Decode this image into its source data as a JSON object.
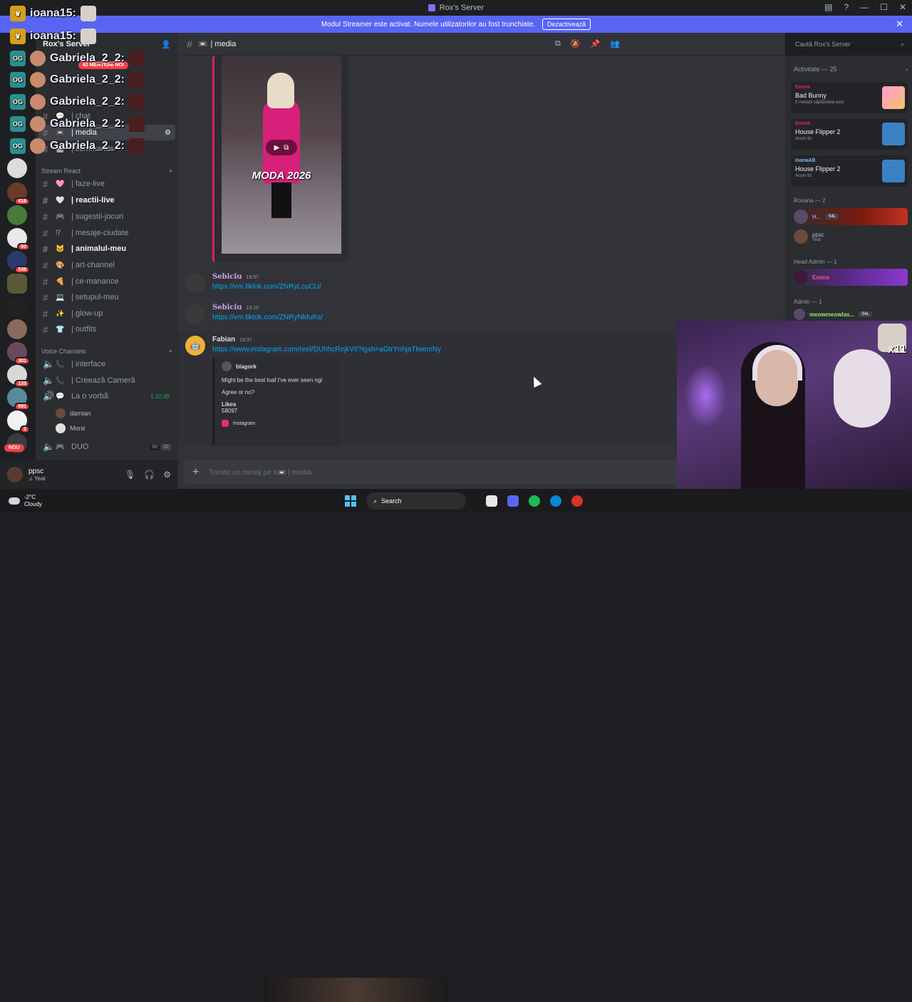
{
  "window": {
    "title": "Rox's Server"
  },
  "banner": {
    "text": "Modul Streamer este activat. Numele utilizatorilor au fost trunchiate.",
    "button": "Dezactivează"
  },
  "server_rail": {
    "badges": [
      "416",
      "60",
      "536",
      "301",
      "133",
      "591",
      "2"
    ],
    "new_label": "NOU"
  },
  "sidebar": {
    "server_name": "Rox's Server",
    "mentions": "62 MENȚIUNI NOI",
    "top_channels": [
      "| chat",
      "| media",
      "| commands"
    ],
    "category_stream": "Stream React",
    "channels": [
      {
        "emoji": "🩷",
        "name": "| faze-live",
        "bold": false
      },
      {
        "emoji": "🤍",
        "name": "| reactii-live",
        "bold": true
      },
      {
        "emoji": "🎮",
        "name": "| sugestii-jocuri",
        "bold": false
      },
      {
        "emoji": "⁉",
        "name": "| mesaje-ciudate",
        "bold": false
      },
      {
        "emoji": "🐱",
        "name": "| animalul-meu",
        "bold": true
      },
      {
        "emoji": "🎨",
        "name": "| art-channel",
        "bold": false
      },
      {
        "emoji": "🍕",
        "name": "| ce-manance",
        "bold": false
      },
      {
        "emoji": "💻",
        "name": "| setupul-meu",
        "bold": false
      },
      {
        "emoji": "✨",
        "name": "| glow-up",
        "bold": false
      },
      {
        "emoji": "👕",
        "name": "| outfits",
        "bold": false
      }
    ],
    "category_voice": "Voice Channels",
    "voice_channels": [
      {
        "emoji": "📞",
        "name": "| interface"
      },
      {
        "emoji": "📞",
        "name": "| Creează Cameră"
      },
      {
        "emoji": "💬",
        "name": "La o vorbă",
        "timer": "1:32:49"
      }
    ],
    "voice_users": [
      "damian",
      "Monii"
    ],
    "duo": {
      "name": "DUO",
      "count_a": "00",
      "count_b": "02"
    }
  },
  "overlay_users": [
    "ioana15:",
    "ioana15:",
    "Gabriela_2_2:",
    "Gabriela_2_2:",
    "Gabriela_2_2:",
    "Gabriela_2_2:",
    "Gabriela_2_2:"
  ],
  "user_bar": {
    "name": "ppsc",
    "status": "Yeat"
  },
  "main": {
    "channel": "| media",
    "search_placeholder": "Caută Rox's Server",
    "video_caption": "MODA 2026",
    "messages": [
      {
        "author": "Sebiciu",
        "time": "18:57",
        "link": "https://vm.tiktok.com/ZNRyLcuCU/"
      },
      {
        "author": "Sebiciu",
        "time": "19:10",
        "link": "https://vm.tiktok.com/ZNRyNMuKs/"
      },
      {
        "author": "Fabian",
        "time": "19:37",
        "link": "https://www.instagram.com/reel/DUhhcRejkVt/?igsh=aGtrYnhjaTlwemNy"
      }
    ],
    "embed": {
      "author": "blagork",
      "line1": "Might be the best loaf I've ever seen ngl",
      "line2": "Agree or no?",
      "likes_label": "Likes",
      "likes_value": "58097",
      "source": "Instagram"
    },
    "composer_placeholder": "Trimite un mesaj pe #📼 | media"
  },
  "members": {
    "activity_title": "Activitate — 25",
    "activities": [
      {
        "user": "Emma",
        "game": "Bad Bunny",
        "meta": "9 melodii săptămâna asta"
      },
      {
        "user": "Emma",
        "game": "House Flipper 2",
        "meta": "Acum 9z"
      },
      {
        "user": "IoanaAB",
        "game": "House Flipper 2",
        "meta": "Acum 8z"
      }
    ],
    "group_roxana": "Roxana — 2",
    "roxana_members": [
      {
        "name": "H...",
        "tag": "S4L"
      },
      {
        "name": "ppsc",
        "sub": "Yeat"
      }
    ],
    "group_head_admin": "Head Admin — 1",
    "head_admin": "Emma",
    "group_admin": "Admin — 1",
    "admin_member": {
      "name": "meowmeowlas...",
      "tag": "S4L"
    }
  },
  "webcam": {
    "sticker_count": "x11"
  },
  "taskbar": {
    "temp": "-2°C",
    "weather": "Cloudy",
    "search": "Search"
  }
}
